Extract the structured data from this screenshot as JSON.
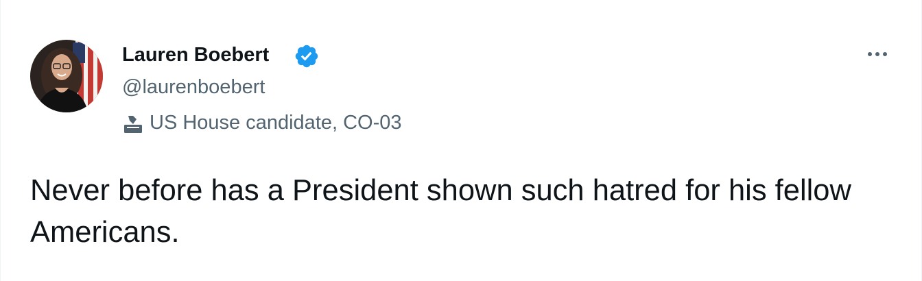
{
  "author": {
    "display_name": "Lauren Boebert",
    "handle": "@laurenboebert",
    "verified": true,
    "label": "US House candidate, CO-03",
    "label_icon": "ballot-box-icon",
    "avatar_icon": "profile-photo"
  },
  "tweet": {
    "text": "Never before has a President shown such hatred for his fellow Americans."
  },
  "menu": {
    "icon": "more-options-icon"
  },
  "colors": {
    "verified_blue": "#1d9bf0",
    "text_primary": "#0f1419",
    "text_secondary": "#536471"
  }
}
